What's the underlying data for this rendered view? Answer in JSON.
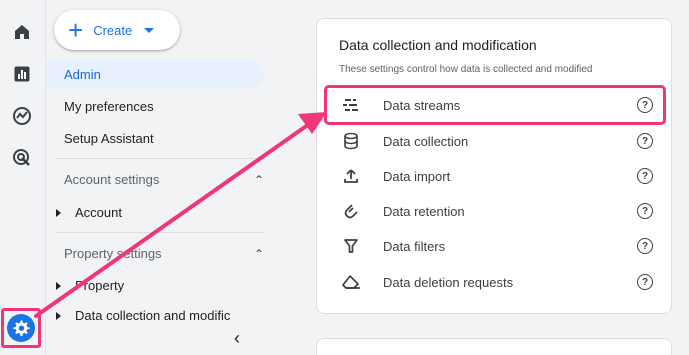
{
  "rail": {
    "icons": [
      "home-icon",
      "reports-icon",
      "explore-icon",
      "advertising-icon"
    ],
    "settings_icon": "gear-icon"
  },
  "create": {
    "label": "Create"
  },
  "nav": {
    "admin": "Admin",
    "my_preferences": "My preferences",
    "setup_assistant": "Setup Assistant",
    "account_settings": "Account settings",
    "account": "Account",
    "property_settings": "Property settings",
    "property": "Property",
    "data_collection_partial": "Data collection and modific"
  },
  "card": {
    "title": "Data collection and modification",
    "subtitle": "These settings control how data is collected and modified",
    "rows": [
      {
        "label": "Data streams",
        "icon": "data-streams-icon",
        "highlighted": true
      },
      {
        "label": "Data collection",
        "icon": "database-icon"
      },
      {
        "label": "Data import",
        "icon": "upload-icon"
      },
      {
        "label": "Data retention",
        "icon": "retention-icon"
      },
      {
        "label": "Data filters",
        "icon": "filter-icon"
      },
      {
        "label": "Data deletion requests",
        "icon": "eraser-icon"
      }
    ]
  },
  "colors": {
    "accent": "#1a73e8",
    "annotation": "#f0357a",
    "active_bg": "#e8f0fe"
  }
}
